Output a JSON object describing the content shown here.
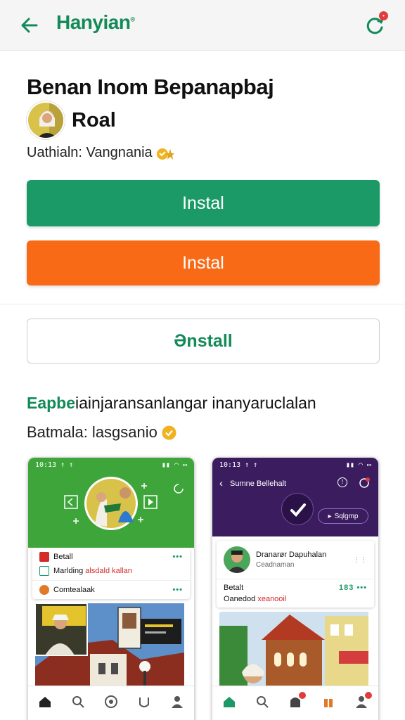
{
  "header": {
    "title": "Hanyian",
    "back_icon": "arrow-left-icon",
    "refresh_icon": "refresh-icon",
    "brand_color": "#138a58"
  },
  "content": {
    "headline": "Benan Inom Bepanapbaj",
    "author": "Roal",
    "meta": "Uathialn: Vangnania"
  },
  "buttons": {
    "install_primary": "Instal",
    "install_secondary": "Instal",
    "install_outline": "Ənstall",
    "green": "#1b9a68",
    "orange": "#f96a17"
  },
  "section": {
    "title_highlight": "Eapbe",
    "title_rest": "iainjaransanlangar inanyaruclalan",
    "subtitle": "Batmala: lasgsanio"
  },
  "preview_left": {
    "status_time": "10:13 ↑ ↑",
    "row1": "Betall",
    "row2_prefix": "Marlding",
    "row2_red": "alsdald kallan",
    "row3": "Comtealaak"
  },
  "preview_right": {
    "status_time": "10:13 ↑ ↑",
    "app_title": "Sumne Bellehalt",
    "pill": "Sqlgmp",
    "user_name": "Dranarør Dapuhalan",
    "user_sub": "Ceadnaman",
    "row_title": "Betalt",
    "row_sub_prefix": "Oanedod",
    "row_sub_red": "xeanooil",
    "row_count": "183"
  }
}
